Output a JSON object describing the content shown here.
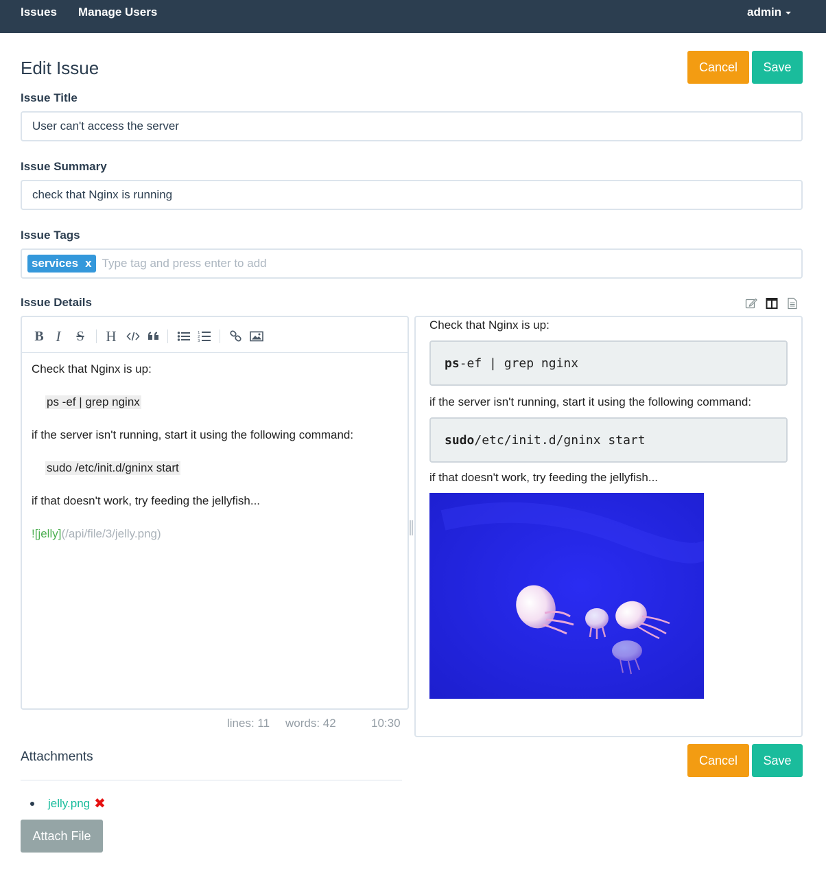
{
  "nav": {
    "issues": "Issues",
    "manage_users": "Manage Users",
    "user_menu": "admin"
  },
  "page": {
    "title": "Edit Issue",
    "cancel_label": "Cancel",
    "save_label": "Save"
  },
  "form": {
    "title_label": "Issue Title",
    "title_value": "User can't access the server",
    "summary_label": "Issue Summary",
    "summary_value": "check that Nginx is running",
    "tags_label": "Issue Tags",
    "tags": [
      {
        "label": "services",
        "remove": "x"
      }
    ],
    "tags_placeholder": "Type tag and press enter to add",
    "details_label": "Issue Details"
  },
  "editor": {
    "toolbar_icons": [
      "bold-icon",
      "italic-icon",
      "strikethrough-icon",
      "heading-icon",
      "code-icon",
      "quote-icon",
      "bullet-list-icon",
      "numbered-list-icon",
      "link-icon",
      "image-icon"
    ],
    "mode_icons": [
      "edit-mode-icon",
      "side-by-side-icon",
      "preview-mode-icon"
    ],
    "lines": [
      "Check that Nginx is up:",
      "ps -ef | grep nginx",
      "if the server isn't running, start it using the following command:",
      "sudo /etc/init.d/gninx start",
      "if that doesn't work, try feeding the jellyfish...",
      "![jelly]",
      "(/api/file/3/jelly.png)"
    ],
    "status": {
      "lines": "lines: 11",
      "words": "words: 42",
      "cursor": "10:30"
    }
  },
  "preview": {
    "p1": "Check that Nginx is up:",
    "code1_cmd": "ps",
    "code1_rest": " -ef | grep nginx",
    "p2": "if the server isn't running, start it using the following command:",
    "code2_cmd": "sudo",
    "code2_rest": " /etc/init.d/gninx start",
    "p3": "if that doesn't work, try feeding the jellyfish...",
    "image_alt": "jelly"
  },
  "attachments": {
    "title": "Attachments",
    "items": [
      {
        "name": "jelly.png"
      }
    ],
    "remove_glyph": "✖",
    "attach_label": "Attach File"
  },
  "colors": {
    "navbar": "#2c3e50",
    "cancel": "#f39c12",
    "save": "#1abc9c",
    "tag": "#3498db",
    "attach_button": "#95a5a6",
    "link": "#18bc9c",
    "remove": "#e61010"
  }
}
